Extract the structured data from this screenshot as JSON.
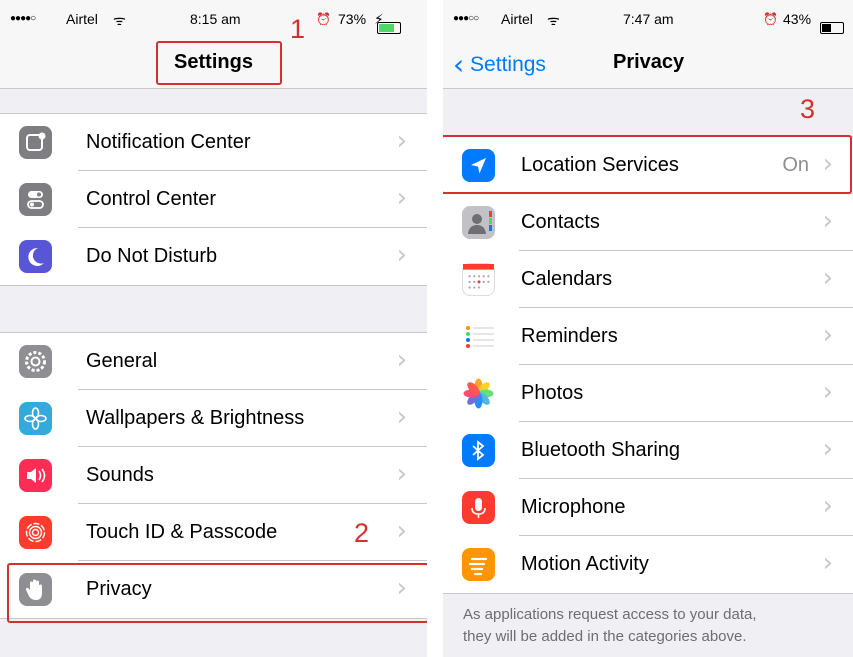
{
  "left": {
    "status": {
      "signal": "●●●●○",
      "carrier": "Airtel",
      "wifi": "ᯤ",
      "time": "8:15 am",
      "alarm": "⏰",
      "battery": "73%"
    },
    "title": "Settings",
    "group1": [
      {
        "label": "Notification Center",
        "icon": "notification-center-icon",
        "color": "#7d7d82"
      },
      {
        "label": "Control Center",
        "icon": "control-center-icon",
        "color": "#7d7d82"
      },
      {
        "label": "Do Not Disturb",
        "icon": "moon-icon",
        "color": "#5856d6"
      }
    ],
    "group2": [
      {
        "label": "General",
        "icon": "gear-icon",
        "color": "#8e8e93"
      },
      {
        "label": "Wallpapers & Brightness",
        "icon": "flower-icon",
        "color": "#34aadc"
      },
      {
        "label": "Sounds",
        "icon": "speaker-icon",
        "color": "#ff2d55"
      },
      {
        "label": "Touch ID & Passcode",
        "icon": "fingerprint-icon",
        "color": "#ff3b30"
      },
      {
        "label": "Privacy",
        "icon": "hand-icon",
        "color": "#8e8e93"
      }
    ],
    "annotations": {
      "step1": "1",
      "step2": "2"
    }
  },
  "right": {
    "status": {
      "signal": "●●●○○",
      "carrier": "Airtel",
      "wifi": "ᯤ",
      "time": "7:47 am",
      "alarm": "⏰",
      "battery": "43%"
    },
    "back_label": "Settings",
    "title": "Privacy",
    "rows": [
      {
        "label": "Location Services",
        "value": "On",
        "icon": "location-arrow-icon",
        "color": "#007aff"
      },
      {
        "label": "Contacts",
        "icon": "contacts-icon",
        "color": "#a0a0a5"
      },
      {
        "label": "Calendars",
        "icon": "calendar-icon",
        "color": "#ffffff"
      },
      {
        "label": "Reminders",
        "icon": "reminders-icon",
        "color": "#ffffff"
      },
      {
        "label": "Photos",
        "icon": "photos-icon",
        "color": "#ffffff"
      },
      {
        "label": "Bluetooth Sharing",
        "icon": "bluetooth-icon",
        "color": "#007aff"
      },
      {
        "label": "Microphone",
        "icon": "microphone-icon",
        "color": "#ff3b30"
      },
      {
        "label": "Motion Activity",
        "icon": "motion-activity-icon",
        "color": "#ff9500"
      }
    ],
    "footer_line1": "As applications request access to your data,",
    "footer_line2": "they will be added in the categories above.",
    "annotations": {
      "step3": "3"
    }
  }
}
